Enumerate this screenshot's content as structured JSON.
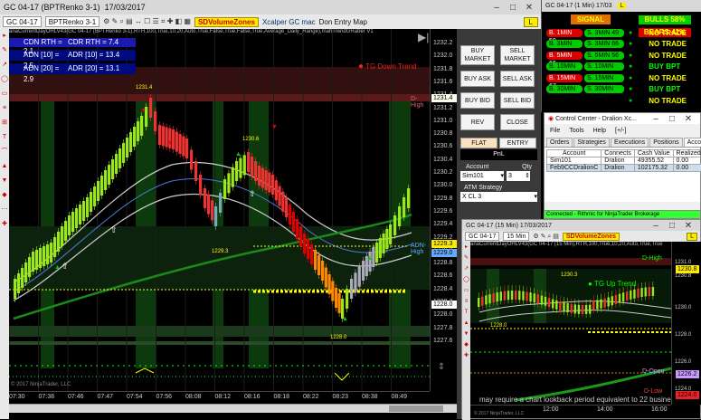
{
  "main": {
    "title": "GC 04-17 (BPTRenko 3-1)",
    "date": "17/03/2017",
    "toolbar": {
      "instrument": "GC 04-17",
      "bartype": "BPTRenko 3-1",
      "sd_label": "SDVolumeZones",
      "xcalper": "Xcalper GC mac",
      "map": "Don Entry Map",
      "l_badge": "L"
    },
    "indicator_line": "anaCurrentDayOHLV43(GC 04-17 (BPTRenko 3-1),RTH,100,True,10,20,Auto,True,False,True,False,True,Average_Daily_Range),mahTrendGRaber V1",
    "stats": {
      "cdn": "CDN RTH = 2.1",
      "cdr": "CDR RTH = 7.4",
      "adn10": "ADN [10] = 2.5",
      "adr10": "ADR [10] = 13.4",
      "adn20": "ADN [20] = 2.9",
      "adr20": "ADR [20] = 13.1"
    },
    "labels": {
      "tg_down": "TG Down Trend",
      "d_high": "D-High",
      "adn_high": "ADN-High",
      "p1231": "1231.4",
      "p1230": "1230.6",
      "p1229": "1229.3",
      "p1228": "1228.0",
      "copyright": "© 2017 NinjaTrader, LLC"
    },
    "axis_prices": [
      "1232.2",
      "1232.0",
      "1231.8",
      "1231.6",
      "1231.4",
      "1231.2",
      "1231.0",
      "1230.8",
      "1230.6",
      "1230.4",
      "1230.2",
      "1230.0",
      "1229.8",
      "1229.6",
      "1229.4",
      "1229.2",
      "1229.0",
      "1228.8",
      "1228.6",
      "1228.4",
      "1228.2",
      "1228.0",
      "1227.8",
      "1227.6"
    ],
    "time_labels": [
      "07:30",
      "07:38",
      "07:46",
      "07:47",
      "07:54",
      "07:56",
      "08:08",
      "08:12",
      "08:16",
      "08:18",
      "08:22",
      "08:23",
      "08:38",
      "08:49"
    ],
    "price_tags": {
      "p1": "1231.4",
      "p2": "1229.3",
      "p3": "1229.0",
      "p4": "1228.0"
    }
  },
  "order_panel": {
    "buy_market": "BUY MARKET",
    "sell_market": "SELL MARKET",
    "buy_ask": "BUY ASK",
    "sell_ask": "SELL ASK",
    "buy_bid": "BUY BID",
    "sell_bid": "SELL BID",
    "rev": "REV",
    "close": "CLOSE",
    "flat": "FLAT",
    "entry": "ENTRY",
    "pnl": "PnL",
    "account_label": "Account",
    "qty_label": "Qty",
    "account_value": "Sim101",
    "qty_value": "3",
    "atm_label": "ATM Strategy",
    "atm_value": "X CL 3"
  },
  "signal_window": {
    "title": "GC 04-17 (1 Min)",
    "date": "17/03",
    "signal": "SIGNAL",
    "bulls": "BULLS 58%",
    "bears": "BEARS 42%",
    "l_badge": "L",
    "rows": [
      {
        "a": "B. 1MIN 50",
        "b": "S. 3MIN 49",
        "status": "NO TRADE",
        "sc": "#ff0"
      },
      {
        "a": "B. 3MIN 65",
        "b": "S. 3MIN 66",
        "status": "NO TRADE",
        "sc": "#ff0"
      },
      {
        "a": "B. 5MIN 66",
        "b": "S. 5MIN 56",
        "status": "NO TRADE",
        "sc": "#ff0"
      },
      {
        "a": "B. 10MIN 74",
        "b": "S. 10MIN 76",
        "status": "BUY BPT",
        "sc": "#0f0"
      },
      {
        "a": "B. 15MIN 67",
        "b": "S. 15MIN 55",
        "status": "NO TRADE",
        "sc": "#ff0"
      },
      {
        "a": "B. 30MIN 54",
        "b": "S. 30MIN 55",
        "status": "BUY BPT",
        "sc": "#0f0"
      },
      {
        "a": "",
        "b": "",
        "status": "NO TRADE",
        "sc": "#ff0"
      }
    ]
  },
  "control_center": {
    "title": "Control Center - Dralion Xc...",
    "menu": [
      "File",
      "Tools",
      "Help",
      "[+/-]"
    ],
    "tabs": [
      "Orders",
      "Strategies",
      "Executions",
      "Positions",
      "Accounts"
    ],
    "columns": [
      "Account",
      "Connects",
      "Cash Value",
      "Realized"
    ],
    "rows": [
      [
        "Sim101",
        "Dralion",
        "49355.52",
        "0.00"
      ],
      [
        "Feb9CCDralionC",
        "Dralion",
        "102175.32",
        "0.00"
      ]
    ],
    "status": "Connected - Rithmic for NinjaTrader Brokerage"
  },
  "chart15": {
    "title": "GC 04-17 (15 Min)",
    "date": "17/03/2017",
    "instrument": "GC 04-17",
    "interval": "15 Min",
    "sd_label": "SDVolumeZones",
    "l_badge": "L",
    "indicator_line": "anaCurrentDayOHLV43(GC 04-17 (15 Min),RTH,100,True,10,20,Auto,True,True",
    "tg_up": "TG Up Trend",
    "d_high": "D-High",
    "d_open": "D-Open",
    "d_low": "D-Low",
    "p1230": "1230.3",
    "p1228": "1228.0",
    "axis_prices": [
      "1231.0",
      "1230.8",
      "1230.0",
      "1228.0",
      "1226.0",
      "1224.0"
    ],
    "time_labels": [
      "12:00",
      "14:00",
      "16:00"
    ],
    "footer": "may require a chart lookback period equivalent to 22 business days",
    "copyright": "© 2017 NinjaTrader, LLC"
  },
  "colors": {
    "bull": "#9be81a",
    "bear": "#e00000",
    "accent_yellow": "#ffeb00"
  }
}
